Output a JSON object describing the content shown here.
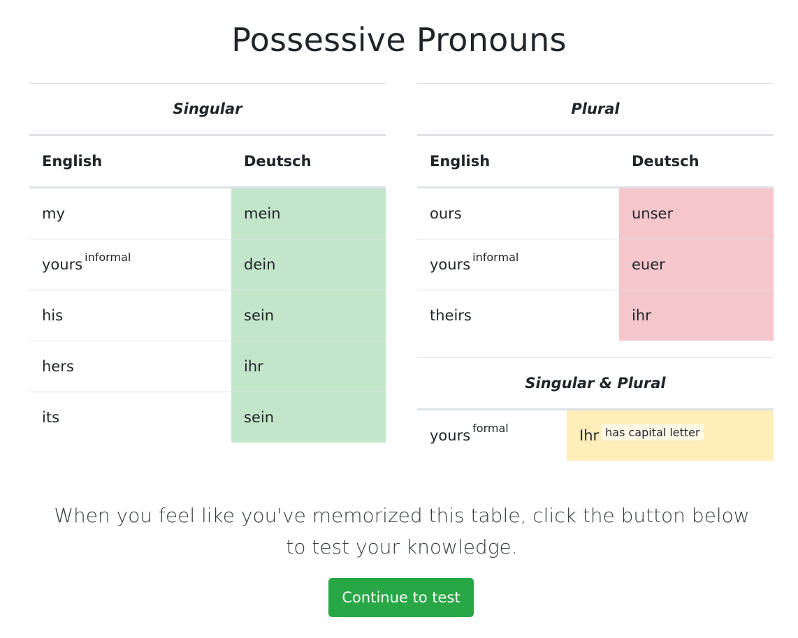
{
  "page": {
    "title": "Possessive Pronouns"
  },
  "singular_table": {
    "caption": "Singular",
    "headers": [
      "English",
      "Deutsch"
    ],
    "rows": [
      {
        "english": "my",
        "note": "",
        "deutsch": "mein"
      },
      {
        "english": "yours",
        "note": "informal",
        "deutsch": "dein"
      },
      {
        "english": "his",
        "note": "",
        "deutsch": "sein"
      },
      {
        "english": "hers",
        "note": "",
        "deutsch": "ihr"
      },
      {
        "english": "its",
        "note": "",
        "deutsch": "sein"
      }
    ],
    "highlight_color": "#c3e6cb"
  },
  "plural_table": {
    "caption": "Plural",
    "headers": [
      "English",
      "Deutsch"
    ],
    "rows": [
      {
        "english": "ours",
        "note": "",
        "deutsch": "unser"
      },
      {
        "english": "yours",
        "note": "informal",
        "deutsch": "euer"
      },
      {
        "english": "theirs",
        "note": "",
        "deutsch": "ihr"
      }
    ],
    "highlight_color": "#f5c6cb"
  },
  "both_table": {
    "caption": "Singular & Plural",
    "rows": [
      {
        "english": "yours",
        "note": "formal",
        "deutsch": "Ihr",
        "hint": "has capital letter"
      }
    ],
    "highlight_color": "#ffeeba"
  },
  "footer": {
    "instructions": "When you feel like you've memorized this table, click the button below to test your knowledge.",
    "button_label": "Continue to test",
    "button_color": "#28a745"
  }
}
